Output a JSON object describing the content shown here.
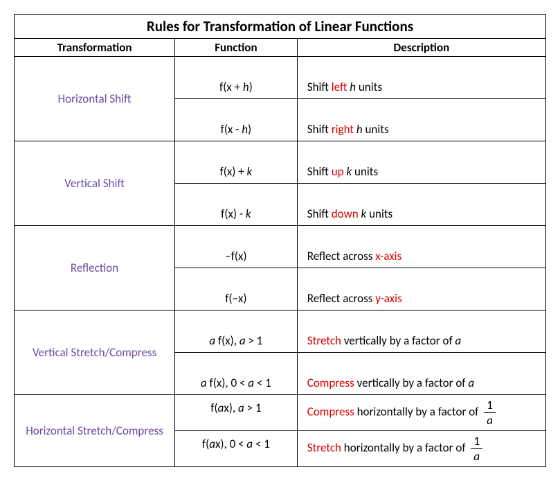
{
  "title": "Rules for Transformation of Linear Functions",
  "headers": {
    "transformation": "Transformation",
    "function": "Function",
    "description": "Description"
  },
  "sections": [
    {
      "name": "Horizontal Shift",
      "rows": [
        {
          "function_prefix": "f(x + ",
          "function_var": "h",
          "function_suffix": ")",
          "desc_pre": "Shift ",
          "desc_red": "left",
          "desc_mid": " ",
          "desc_var": "h",
          "desc_post": " units"
        },
        {
          "function_prefix": "f(x  - ",
          "function_var": "h",
          "function_suffix": ")",
          "desc_pre": "Shift ",
          "desc_red": "right",
          "desc_mid": " ",
          "desc_var": "h",
          "desc_post": " units"
        }
      ]
    },
    {
      "name": "Vertical Shift",
      "rows": [
        {
          "function_prefix": "f(x) + ",
          "function_var": "k",
          "function_suffix": "",
          "desc_pre": "Shift ",
          "desc_red": "up",
          "desc_mid": " ",
          "desc_var": "k",
          "desc_post": " units"
        },
        {
          "function_prefix": "f(x) - ",
          "function_var": "k",
          "function_suffix": "",
          "desc_pre": "Shift ",
          "desc_red": "down",
          "desc_mid": " ",
          "desc_var": "k",
          "desc_post": " units"
        }
      ]
    },
    {
      "name": "Reflection",
      "rows": [
        {
          "function_plain": "–f(x)",
          "desc_pre": "Reflect across ",
          "desc_red": "x-axis"
        },
        {
          "function_plain": "f(–x)",
          "desc_pre": "Reflect across ",
          "desc_red": "y-axis"
        }
      ]
    },
    {
      "name": "Vertical Stretch/Compress",
      "rows": [
        {
          "fvar": "a",
          "fmid": " f(x), ",
          "fvar2": "a",
          "fcond": " > 1",
          "desc_red": "Stretch",
          "desc_mid": " vertically by a factor of ",
          "desc_var": "a"
        },
        {
          "fvar": "a",
          "fmid": " f(x), 0 < ",
          "fvar2": "a",
          "fcond": " < 1",
          "desc_red": "Compress",
          "desc_mid": " vertically by a factor of ",
          "desc_var": "a"
        }
      ]
    },
    {
      "name": "Horizontal Stretch/Compress",
      "rows": [
        {
          "fpre": "f(",
          "fvar": "a",
          "fmid": "x), ",
          "fvar2": "a",
          "fcond": " > 1",
          "desc_red": "Compress",
          "desc_mid": " horizontally by a factor of ",
          "frac_num": "1",
          "frac_den": "a"
        },
        {
          "fpre": "f(",
          "fvar": "a",
          "fmid": "x), 0 < ",
          "fvar2": "a",
          "fcond": " < 1",
          "desc_red": "Stretch",
          "desc_mid": " horizontally by a factor of ",
          "frac_num": "1",
          "frac_den": "a"
        }
      ]
    }
  ]
}
